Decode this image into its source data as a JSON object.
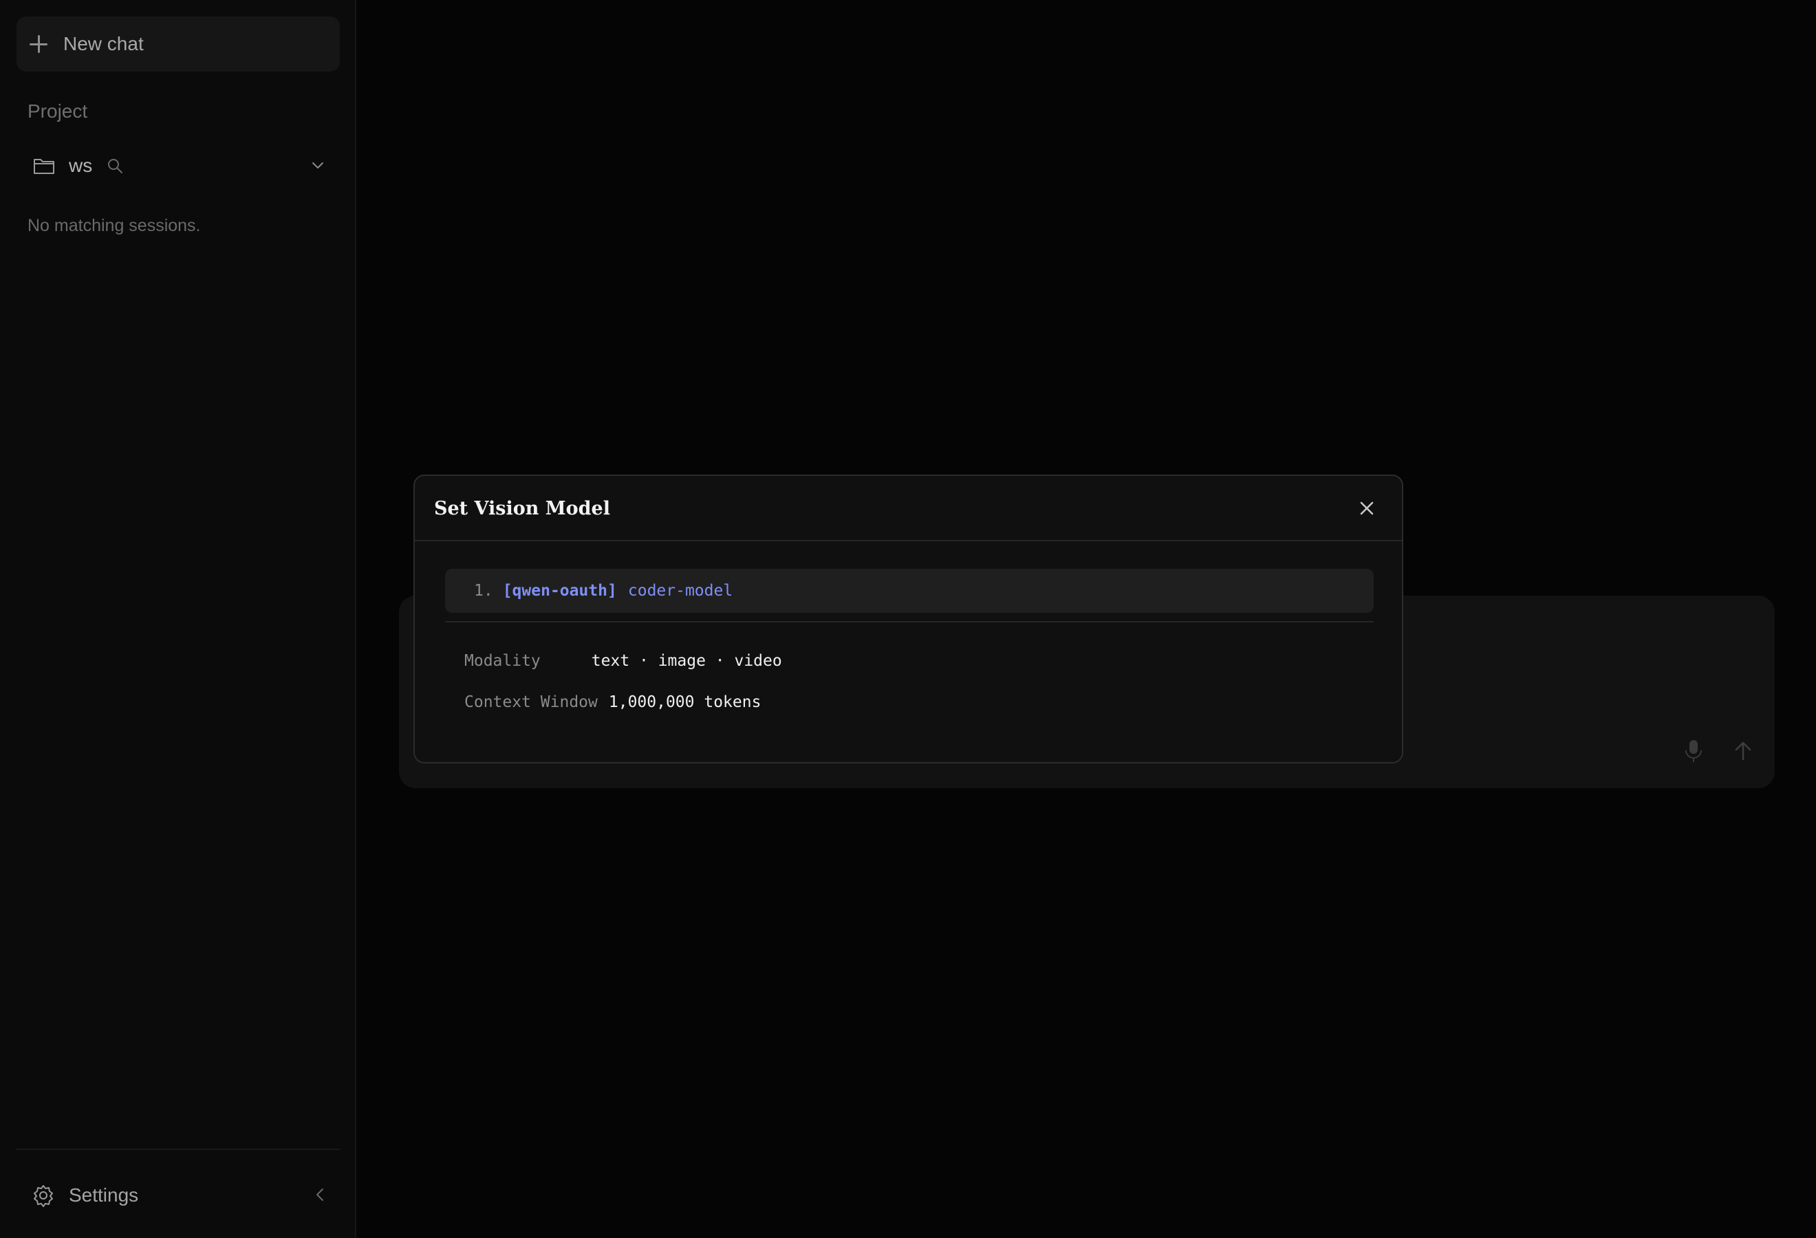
{
  "sidebar": {
    "new_chat_label": "New chat",
    "section_label": "Project",
    "project_name": "ws",
    "empty_message": "No matching sessions.",
    "settings_label": "Settings"
  },
  "modal": {
    "title": "Set Vision Model",
    "models": [
      {
        "index": "1.",
        "provider": "[qwen-oauth]",
        "model": "coder-model"
      }
    ],
    "modality_label": "Modality",
    "modality_value": "text · image · video",
    "context_label": "Context Window",
    "context_value": "1,000,000 tokens"
  },
  "icons": {
    "new_chat": "plus-icon",
    "project": "folder-icon",
    "search": "search-icon",
    "expand": "chevron-down-icon",
    "settings": "gear-icon",
    "collapse": "chevron-left-icon",
    "close": "close-icon",
    "mic": "microphone-icon",
    "send": "arrow-up-icon"
  },
  "colors": {
    "background": "#050505",
    "sidebar": "#0b0b0b",
    "modal_bg": "#101010",
    "accent": "#7f8ff5"
  }
}
